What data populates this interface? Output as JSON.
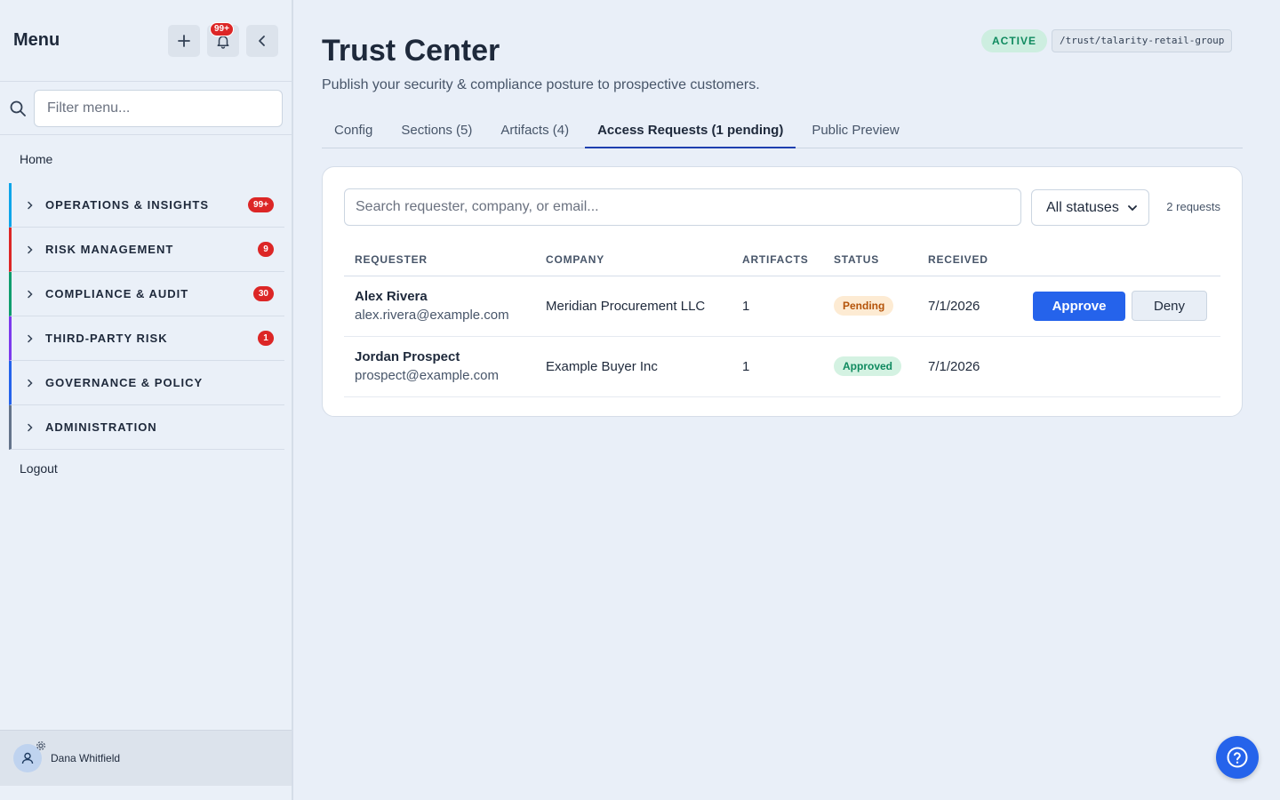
{
  "sidebar": {
    "title": "Menu",
    "notification_count": "99+",
    "filter_placeholder": "Filter menu...",
    "home": "Home",
    "groups": [
      {
        "label": "OPERATIONS & INSIGHTS",
        "badge": "99+",
        "color": "#0ea5e9"
      },
      {
        "label": "RISK MANAGEMENT",
        "badge": "9",
        "color": "#dc2626"
      },
      {
        "label": "COMPLIANCE & AUDIT",
        "badge": "30",
        "color": "#0f9d6e"
      },
      {
        "label": "THIRD-PARTY RISK",
        "badge": "1",
        "color": "#7c3aed"
      },
      {
        "label": "GOVERNANCE & POLICY",
        "badge": "",
        "color": "#2563eb"
      },
      {
        "label": "ADMINISTRATION",
        "badge": "",
        "color": "#64748b"
      }
    ],
    "logout": "Logout",
    "user_name": "Dana Whitfield"
  },
  "header": {
    "title": "Trust Center",
    "subtitle": "Publish your security & compliance posture to prospective customers.",
    "status_badge": "ACTIVE",
    "slug": "/trust/talarity-retail-group"
  },
  "tabs": [
    {
      "label": "Config",
      "active": false
    },
    {
      "label": "Sections (5)",
      "active": false
    },
    {
      "label": "Artifacts (4)",
      "active": false
    },
    {
      "label": "Access Requests (1 pending)",
      "active": true
    },
    {
      "label": "Public Preview",
      "active": false
    }
  ],
  "requests": {
    "search_placeholder": "Search requester, company, or email...",
    "status_filter": "All statuses",
    "count_text": "2 requests",
    "columns": [
      "REQUESTER",
      "COMPANY",
      "ARTIFACTS",
      "STATUS",
      "RECEIVED",
      ""
    ],
    "rows": [
      {
        "name": "Alex Rivera",
        "email": "alex.rivera@example.com",
        "company": "Meridian Procurement LLC",
        "artifacts": "1",
        "status": "Pending",
        "received": "7/1/2026",
        "approve_label": "Approve",
        "deny_label": "Deny"
      },
      {
        "name": "Jordan Prospect",
        "email": "prospect@example.com",
        "company": "Example Buyer Inc",
        "artifacts": "1",
        "status": "Approved",
        "received": "7/1/2026"
      }
    ]
  },
  "colors": {
    "accent": "#2563eb",
    "danger": "#dc2626",
    "success": "#0f8a5f",
    "warning": "#b45309"
  },
  "icons": [
    "plus-icon",
    "bell-icon",
    "chevron-left-icon",
    "search-icon",
    "chevron-right-icon",
    "user-icon",
    "gear-icon",
    "chevron-down-icon",
    "help-icon"
  ]
}
